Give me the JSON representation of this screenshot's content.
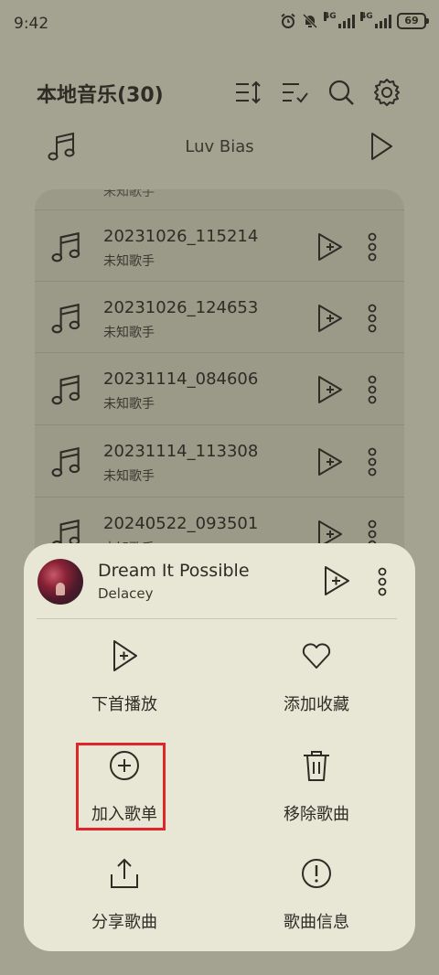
{
  "status_bar": {
    "time": "9:42",
    "icons": [
      "alarm-icon",
      "mute-bell-icon"
    ],
    "network_1": "4G",
    "network_2": "4G",
    "battery": "69"
  },
  "header": {
    "title": "本地音乐(30)",
    "icons": [
      "sort-icon",
      "multi-select-icon",
      "search-icon",
      "gear-icon"
    ]
  },
  "now_playing": {
    "title": "Luv Bias"
  },
  "list": {
    "rows": [
      {
        "name": "20231026_115214",
        "artist": "未知歌手"
      },
      {
        "name": "20231026_124653",
        "artist": "未知歌手"
      },
      {
        "name": "20231114_084606",
        "artist": "未知歌手"
      },
      {
        "name": "20231114_113308",
        "artist": "未知歌手"
      },
      {
        "name": "20240522_093501",
        "artist": "未知歌手"
      }
    ]
  },
  "sheet": {
    "song_name": "Dream It Possible",
    "song_artist": "Delacey",
    "actions": {
      "play_next": "下首播放",
      "favorite": "添加收藏",
      "add_to_playlist": "加入歌单",
      "remove": "移除歌曲",
      "share": "分享歌曲",
      "info": "歌曲信息"
    }
  },
  "colors": {
    "background": "#a4a291",
    "sheet": "#e8e6d4",
    "highlight": "#e0242a"
  }
}
